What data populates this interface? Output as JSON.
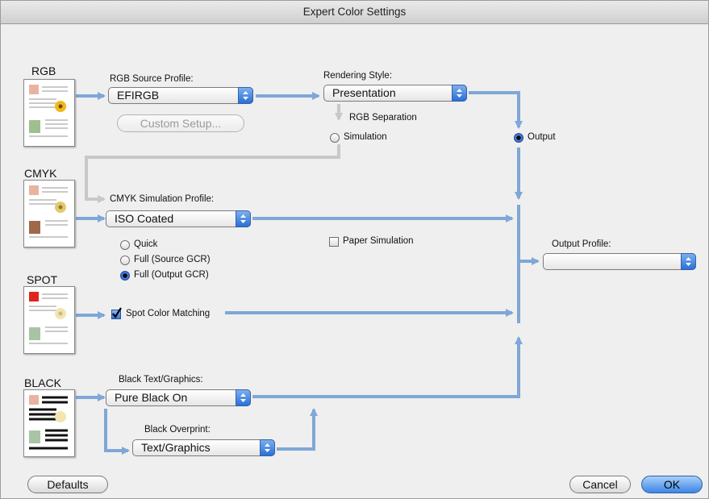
{
  "window": {
    "title": "Expert Color Settings"
  },
  "sections": {
    "rgb": "RGB",
    "cmyk": "CMYK",
    "spot": "SPOT",
    "black": "BLACK"
  },
  "rgb_source": {
    "label": "RGB Source Profile:",
    "value": "EFIRGB"
  },
  "custom_setup": {
    "label": "Custom Setup..."
  },
  "rendering": {
    "label": "Rendering Style:",
    "value": "Presentation"
  },
  "rgb_separation": {
    "label": "RGB Separation",
    "simulation": "Simulation",
    "output": "Output",
    "selected": "Output"
  },
  "cmyk_sim": {
    "label": "CMYK Simulation Profile:",
    "value": "ISO Coated"
  },
  "cmyk_method": {
    "options": [
      "Quick",
      "Full (Source GCR)",
      "Full (Output GCR)"
    ],
    "selected": "Full (Output GCR)"
  },
  "paper_sim": {
    "label": "Paper Simulation",
    "checked": false
  },
  "output_profile": {
    "label": "Output Profile:",
    "value": ""
  },
  "spot": {
    "label": "Spot Color Matching",
    "checked": true
  },
  "black_text": {
    "label": "Black Text/Graphics:",
    "value": "Pure Black On"
  },
  "black_overprint": {
    "label": "Black Overprint:",
    "value": "Text/Graphics"
  },
  "buttons": {
    "defaults": "Defaults",
    "cancel": "Cancel",
    "ok": "OK"
  },
  "colors": {
    "flow": "#7fa7d8",
    "flow_inactive": "#c8c8c8",
    "accent": "#3d86e6"
  }
}
